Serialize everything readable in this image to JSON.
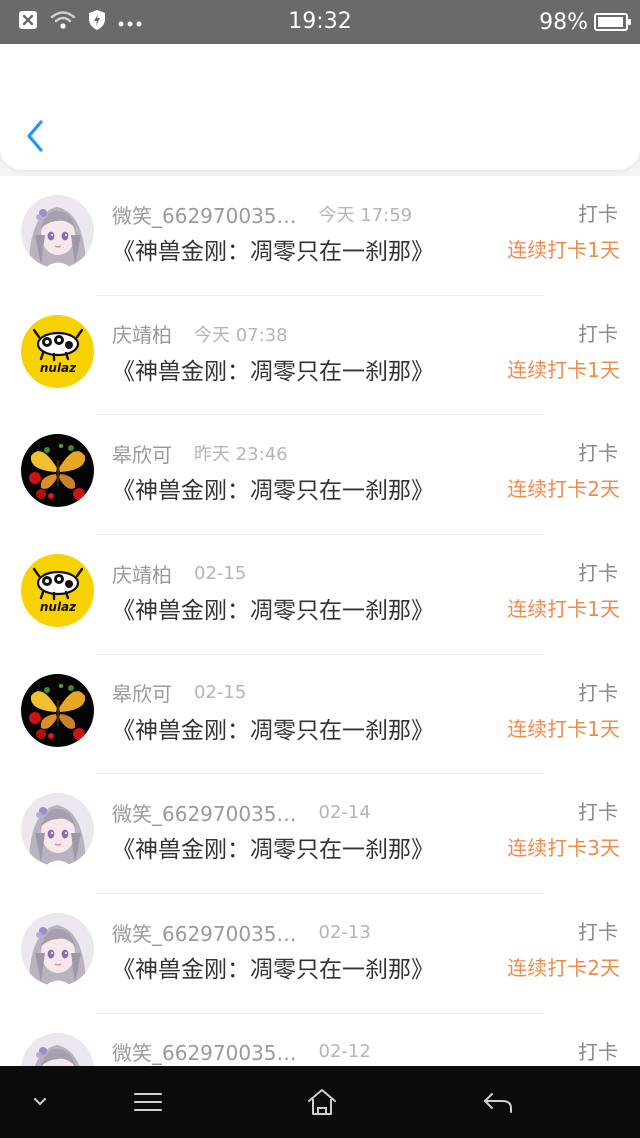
{
  "status_bar": {
    "time": "19:32",
    "battery": "98%",
    "battery_level": 0.98,
    "icons": [
      "close-notification-icon",
      "wifi-icon",
      "shield-icon",
      "more-dots-icon",
      "battery-icon"
    ]
  },
  "header": {
    "back_icon": "chevron-left-icon",
    "accent_color": "#2196f3"
  },
  "colors": {
    "streak": "#f08a4b",
    "username": "#9a9a9a",
    "timestamp": "#b5b5b5",
    "title": "#333333"
  },
  "checkins": [
    {
      "user": "微笑_662970035…",
      "time": "今天 17:59",
      "title": "《神兽金刚：凋零只在一刹那》",
      "action": "打卡",
      "streak": "连续打卡1天",
      "avatar": "anime-girl"
    },
    {
      "user": "庆靖柏",
      "time": "今天 07:38",
      "title": "《神兽金刚：凋零只在一刹那》",
      "action": "打卡",
      "streak": "连续打卡1天",
      "avatar": "nulaz-cow"
    },
    {
      "user": "皋欣可",
      "time": "昨天 23:46",
      "title": "《神兽金刚：凋零只在一刹那》",
      "action": "打卡",
      "streak": "连续打卡2天",
      "avatar": "butterfly"
    },
    {
      "user": "庆靖柏",
      "time": "02-15",
      "title": "《神兽金刚：凋零只在一刹那》",
      "action": "打卡",
      "streak": "连续打卡1天",
      "avatar": "nulaz-cow"
    },
    {
      "user": "皋欣可",
      "time": "02-15",
      "title": "《神兽金刚：凋零只在一刹那》",
      "action": "打卡",
      "streak": "连续打卡1天",
      "avatar": "butterfly"
    },
    {
      "user": "微笑_662970035…",
      "time": "02-14",
      "title": "《神兽金刚：凋零只在一刹那》",
      "action": "打卡",
      "streak": "连续打卡3天",
      "avatar": "anime-girl"
    },
    {
      "user": "微笑_662970035…",
      "time": "02-13",
      "title": "《神兽金刚：凋零只在一刹那》",
      "action": "打卡",
      "streak": "连续打卡2天",
      "avatar": "anime-girl"
    },
    {
      "user": "微笑_662970035…",
      "time": "02-12",
      "title": "",
      "action": "打卡",
      "streak": "",
      "avatar": "anime-girl"
    }
  ],
  "nav_bar": {
    "icons": [
      "chevron-down-icon",
      "menu-icon",
      "home-icon",
      "back-arrow-icon"
    ]
  }
}
